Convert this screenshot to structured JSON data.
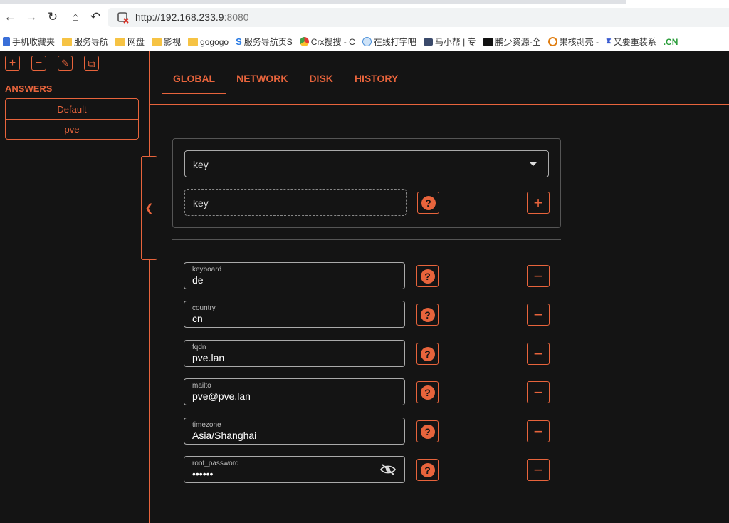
{
  "browser": {
    "url_host": "http://192.168.233.9",
    "url_port": ":8080",
    "bookmarks": [
      "手机收藏夹",
      "服务导航",
      "网盘",
      "影视",
      "gogogo",
      "服务导航页S",
      "Crx搜搜 - C",
      "在线打字吧",
      "马小帮 | 专",
      "鹏少资源-全",
      "果核剥壳 -",
      "又要重装系",
      ".CN"
    ]
  },
  "sidebar": {
    "tools": [
      "+",
      "−",
      "✎",
      "⧉"
    ],
    "answers_title": "ANSWERS",
    "answers": [
      "Default",
      "pve"
    ]
  },
  "tabs": [
    "GLOBAL",
    "NETWORK",
    "DISK",
    "HISTORY"
  ],
  "add": {
    "select_value": "key",
    "input_placeholder": "key",
    "add_label": "+",
    "help_label": "?"
  },
  "fields": [
    {
      "label": "keyboard",
      "value": "de"
    },
    {
      "label": "country",
      "value": "cn"
    },
    {
      "label": "fqdn",
      "value": "pve.lan"
    },
    {
      "label": "mailto",
      "value": "pve@pve.lan"
    },
    {
      "label": "timezone",
      "value": "Asia/Shanghai"
    },
    {
      "label": "root_password",
      "value": "••••••"
    }
  ],
  "remove_label": "−",
  "accent_color": "#e8643c"
}
